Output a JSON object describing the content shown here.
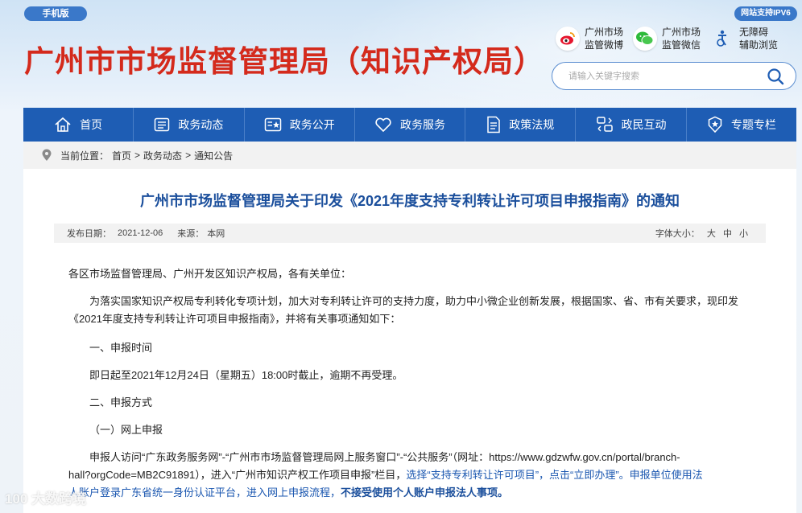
{
  "header": {
    "mobile_label": "手机版",
    "ipv6_label": "网站支持IPV6",
    "site_title": "广州市市场监督管理局（知识产权局）",
    "social": [
      {
        "line1": "广州市场",
        "line2": "监管微博",
        "icon": "weibo-icon"
      },
      {
        "line1": "广州市场",
        "line2": "监管微信",
        "icon": "wechat-icon"
      },
      {
        "line1": "无障碍",
        "line2": "辅助浏览",
        "icon": "accessibility-icon"
      }
    ],
    "search_placeholder": "请输入关键字搜索"
  },
  "nav": {
    "items": [
      {
        "label": "首页",
        "icon": "home-icon"
      },
      {
        "label": "政务动态",
        "icon": "news-icon"
      },
      {
        "label": "政务公开",
        "icon": "open-gov-icon"
      },
      {
        "label": "政务服务",
        "icon": "heart-icon"
      },
      {
        "label": "政策法规",
        "icon": "document-icon"
      },
      {
        "label": "政民互动",
        "icon": "interaction-icon"
      },
      {
        "label": "专题专栏",
        "icon": "badge-icon"
      }
    ]
  },
  "breadcrumb": {
    "prefix": "当前位置：",
    "items": [
      "首页",
      "政务动态",
      "通知公告"
    ],
    "separator": ">"
  },
  "article": {
    "title": "广州市市场监督管理局关于印发《2021年度支持专利转让许可项目申报指南》的通知",
    "meta": {
      "date_label": "发布日期：",
      "date": "2021-12-06",
      "source_label": "来源：",
      "source": "本网",
      "font_size_label": "字体大小：",
      "font_sizes": [
        "大",
        "中",
        "小"
      ]
    },
    "paragraphs": {
      "salutation": "各区市场监督管理局、广州开发区知识产权局，各有关单位：",
      "intro_1": "为落实国家知识产权局专利转化专项计划，加大对专利转让许可的支持力度，助力中小微企业创新发展，根据国家、省、市有关要求，现印发",
      "intro_2": "《2021年度支持专利转让许可项目申报指南》，并将有关事项通知如下：",
      "h1": "一、申报时间",
      "time": "即日起至2021年12月24日（星期五）18:00时截止，逾期不再受理。",
      "h2": "二、申报方式",
      "h2_1": "（一）网上申报",
      "apply_1": "申报人访问“广东政务服务网”-“广州市市场监督管理局网上服务窗口”-“公共服务”（网址：https://www.gdzwfw.gov.cn/portal/branch-",
      "apply_2a": "hall?orgCode=MB2C91891），进入“广州市知识产权工作项目申报”栏目，",
      "apply_2b": "选择“支持专利转让许可项目”，点击“立即办理”。申报单位使用法",
      "apply_3a": "人账户登录广东省统一身份认证平台，进入网上申报流程，",
      "apply_3b": "不接受使用个人账户申报法人事项。"
    }
  },
  "watermark": "100 大数跨境",
  "colors": {
    "nav_bg": "#1e5db4",
    "title_red": "#d42a1c",
    "article_title": "#1b4f9c"
  }
}
